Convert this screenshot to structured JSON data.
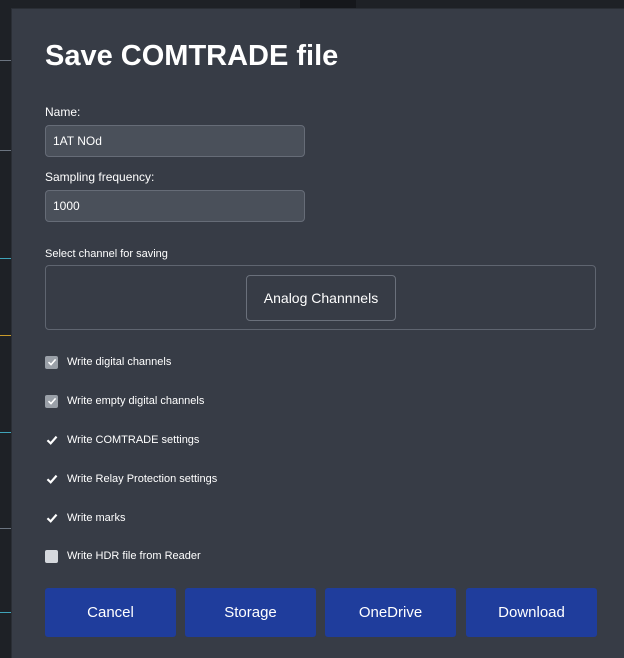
{
  "dialog": {
    "title": "Save COMTRADE file"
  },
  "name_field": {
    "label": "Name:",
    "value": "1AT NOd"
  },
  "sampling_field": {
    "label": "Sampling frequency:",
    "value": "1000"
  },
  "channels": {
    "label": "Select channel for saving",
    "analog_button": "Analog Channnels"
  },
  "options": [
    {
      "label": "Write digital channels",
      "state": "checked-disabled"
    },
    {
      "label": "Write empty digital channels",
      "state": "checked-disabled"
    },
    {
      "label": "Write COMTRADE settings",
      "state": "checked"
    },
    {
      "label": "Write Relay Protection settings",
      "state": "checked"
    },
    {
      "label": "Write marks",
      "state": "checked"
    },
    {
      "label": "Write HDR file from Reader",
      "state": "unchecked"
    }
  ],
  "buttons": {
    "cancel": "Cancel",
    "storage": "Storage",
    "onedrive": "OneDrive",
    "download": "Download"
  },
  "colors": {
    "dialog_bg": "#373c46",
    "button_bg": "#1f3d9c",
    "text": "#ffffff"
  }
}
